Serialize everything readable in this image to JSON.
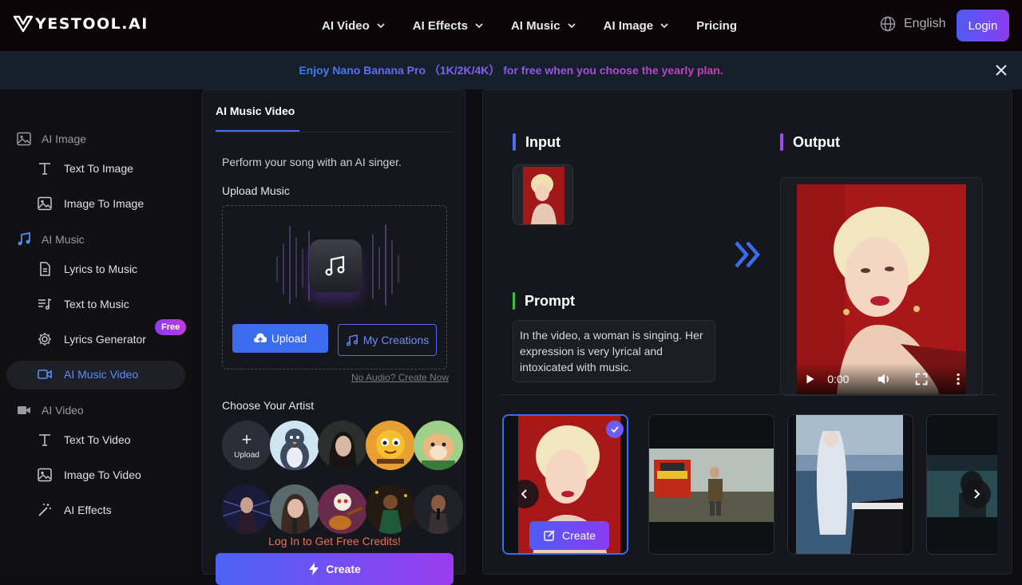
{
  "header": {
    "logo": "YESTOOL.AI",
    "nav": [
      {
        "label": "AI Video",
        "has_menu": true
      },
      {
        "label": "AI Effects",
        "has_menu": true
      },
      {
        "label": "AI Music",
        "has_menu": true
      },
      {
        "label": "AI Image",
        "has_menu": true
      },
      {
        "label": "Pricing",
        "has_menu": false
      }
    ],
    "language": "English",
    "login": "Login"
  },
  "banner": {
    "text": "Enjoy Nano Banana Pro （1K/2K/4K） for free when you choose the yearly plan."
  },
  "sidebar": {
    "sections": [
      {
        "label": "AI Image",
        "icon": "image-icon",
        "items": [
          {
            "label": "Text To Image",
            "icon": "text-icon"
          },
          {
            "label": "Image To Image",
            "icon": "image-icon"
          }
        ]
      },
      {
        "label": "AI Music",
        "icon": "music-note-icon",
        "items": [
          {
            "label": "Lyrics to Music",
            "icon": "document-icon"
          },
          {
            "label": "Text to Music",
            "icon": "playlist-icon"
          },
          {
            "label": "Lyrics Generator",
            "icon": "gear-icon",
            "badge": "Free"
          },
          {
            "label": "AI Music Video",
            "icon": "video-camera-icon",
            "active": true
          }
        ]
      },
      {
        "label": "AI Video",
        "icon": "video-camera-icon",
        "items": [
          {
            "label": "Text To Video",
            "icon": "text-icon"
          },
          {
            "label": "Image To Video",
            "icon": "image-icon"
          },
          {
            "label": "AI Effects",
            "icon": "magic-wand-icon"
          }
        ]
      }
    ]
  },
  "panel": {
    "tab": "AI Music Video",
    "description": "Perform your song with an AI singer.",
    "upload_label": "Upload Music",
    "upload_button": "Upload",
    "creations_button": "My Creations",
    "no_audio_link": "No Audio? Create Now",
    "artist_label": "Choose Your Artist",
    "artist_upload": "Upload",
    "credits_link": "Log In to Get Free Credits!",
    "create_button": "Create"
  },
  "showcase": {
    "input_title": "Input",
    "prompt_title": "Prompt",
    "prompt_text": "In the video, a woman is singing. Her expression is very lyrical and intoxicated with music.",
    "output_title": "Output",
    "video_time": "0:00",
    "card_create": "Create"
  },
  "colors": {
    "accent_blue": "#3b6cf0",
    "accent_purple": "#8a3cf0",
    "input_bar": "#4a6ef5",
    "prompt_bar": "#3cc04a",
    "output_bar": "#9a4cf0",
    "credits": "#e8705a"
  }
}
